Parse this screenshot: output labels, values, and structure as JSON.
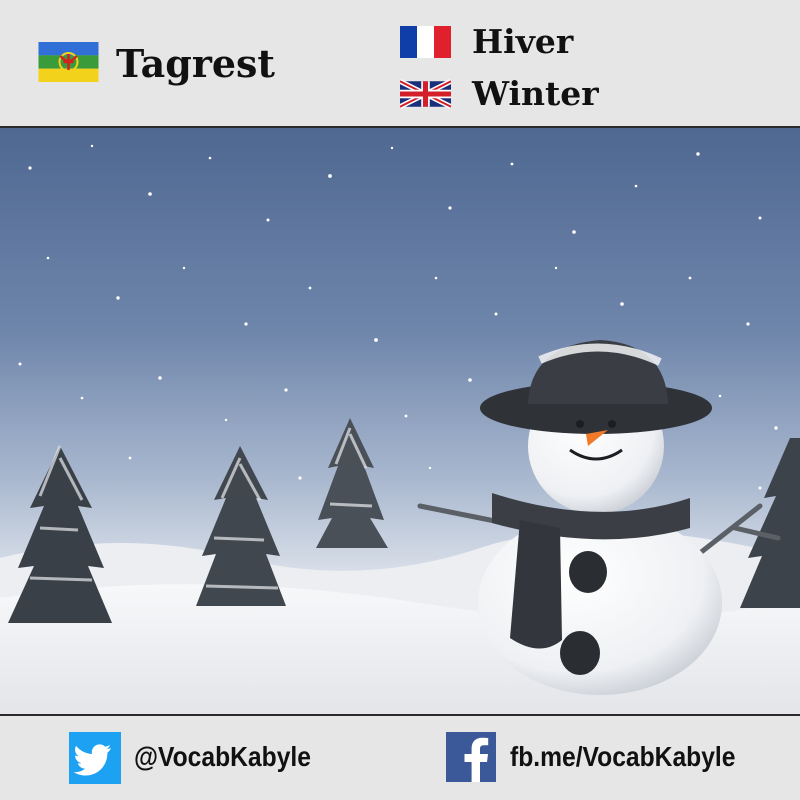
{
  "header": {
    "kabyle": {
      "flag_icon": "kabyle-flag-icon",
      "word": "Tagrest"
    },
    "french": {
      "flag_icon": "france-flag-icon",
      "word": "Hiver"
    },
    "english": {
      "flag_icon": "uk-flag-icon",
      "word": "Winter"
    }
  },
  "image": {
    "subject": "snowman-winter-photo"
  },
  "footer": {
    "twitter": {
      "icon": "twitter-bird-icon",
      "handle": "@VocabKabyle",
      "color": "#1da1f2"
    },
    "facebook": {
      "icon": "facebook-f-icon",
      "link": "fb.me/VocabKabyle",
      "color": "#3b5998"
    }
  },
  "colors": {
    "panel": "#e6e6e6",
    "divider": "#2a2a2a",
    "sky_top": "#5a7398",
    "snow": "#f4f5f7"
  }
}
